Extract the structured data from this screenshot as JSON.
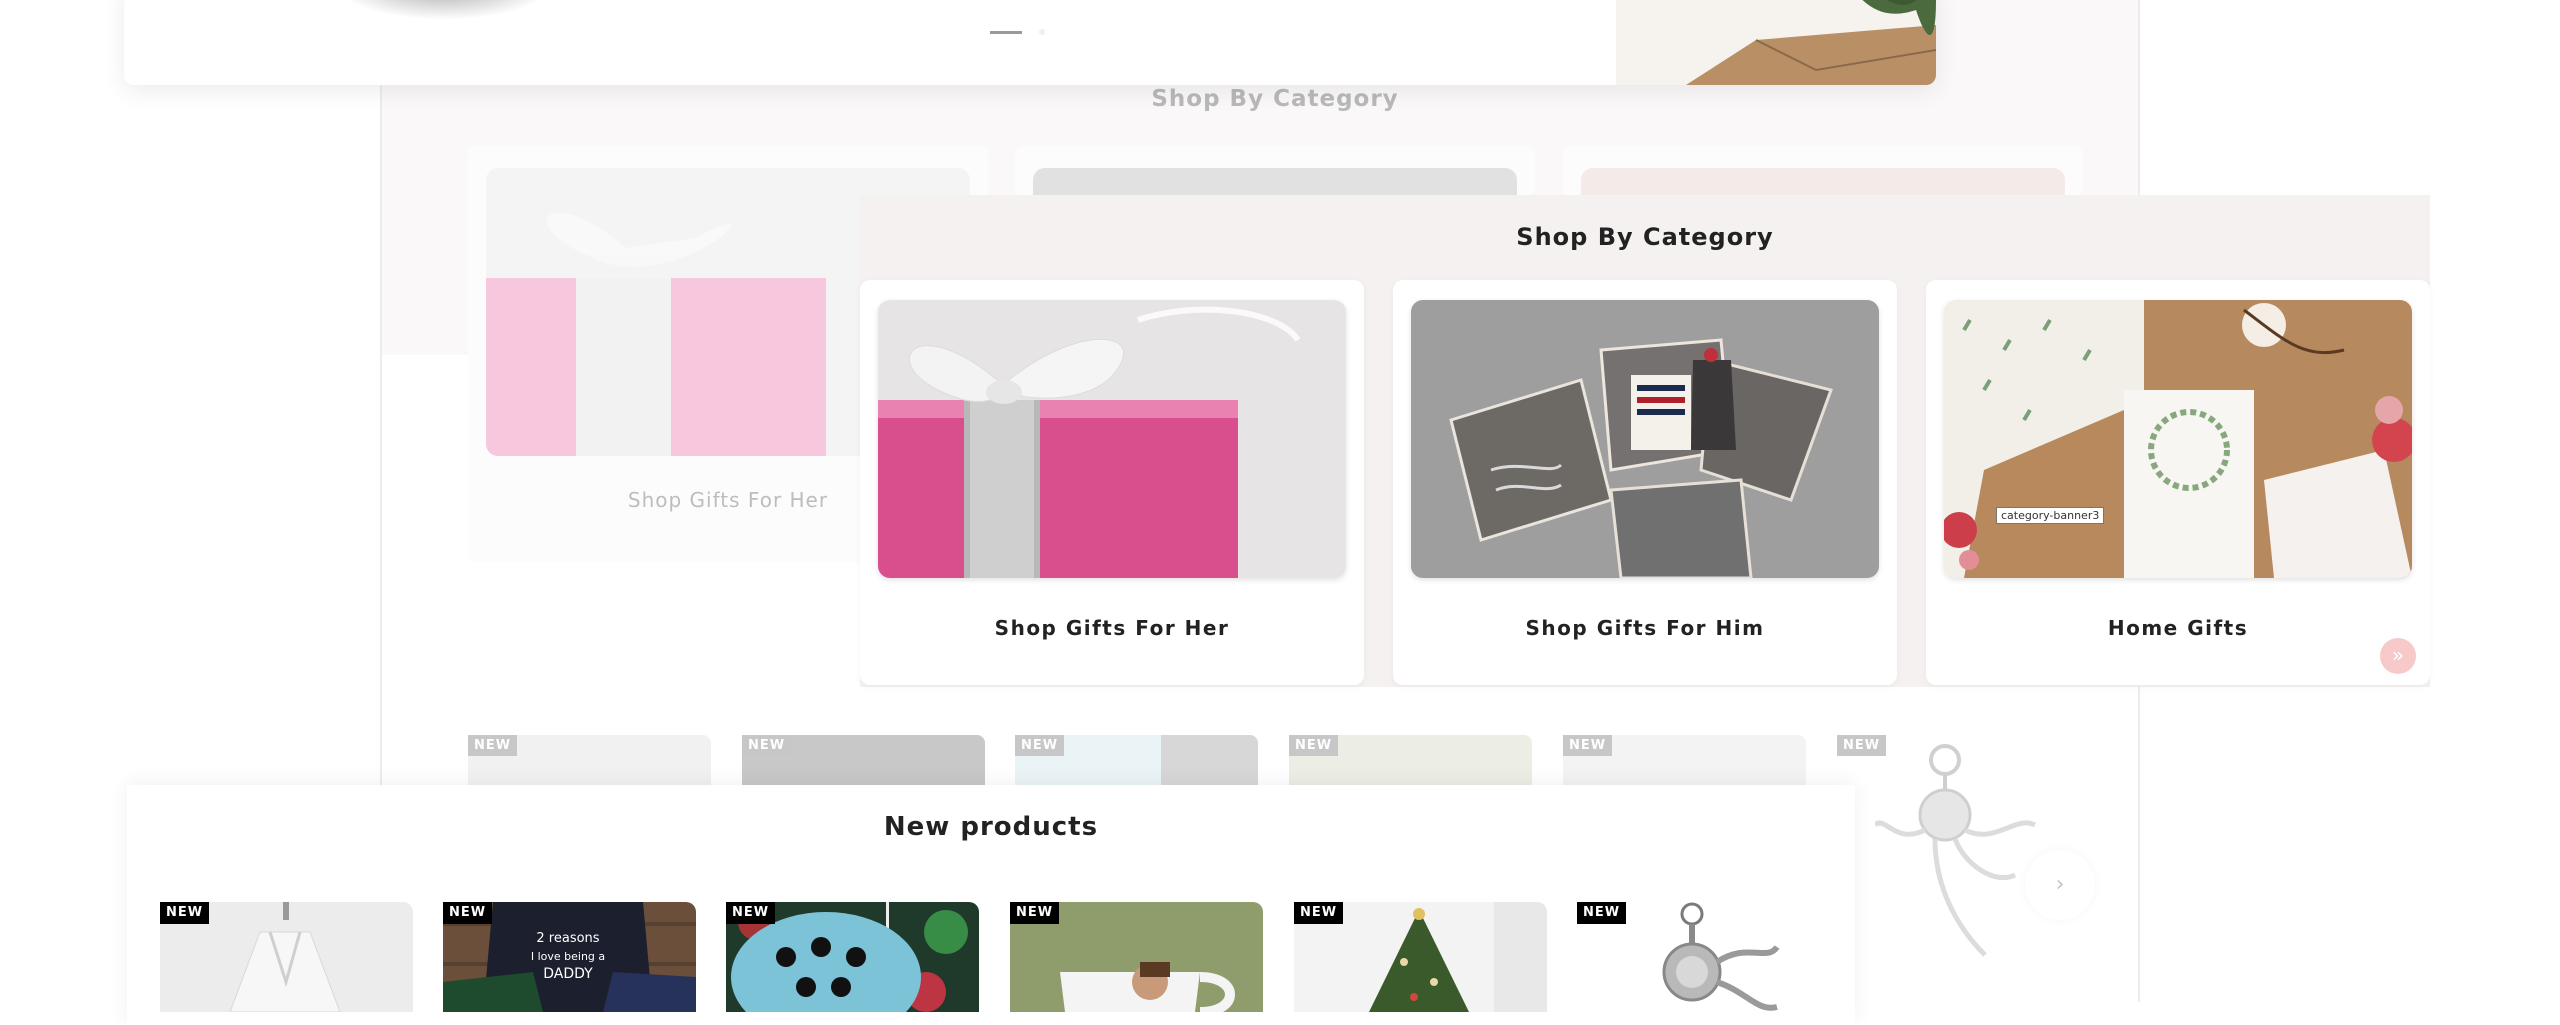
{
  "background": {
    "section_title": "Shop By Category",
    "first_card_label": "Shop Gifts For Her",
    "new_badges": [
      "NEW",
      "NEW",
      "NEW",
      "NEW",
      "NEW",
      "NEW"
    ],
    "carousel_next_icon": "chevron-right-icon"
  },
  "category_section": {
    "title": "Shop By Category",
    "cards": [
      {
        "label": "Shop Gifts For Her",
        "image": "pink-gift-box"
      },
      {
        "label": "Shop Gifts For Him",
        "image": "explosion-gift-box"
      },
      {
        "label": "Home Gifts",
        "image": "stationery-flowers",
        "tooltip": "category-banner3"
      }
    ],
    "next_button_icon": "double-chevron-right-icon"
  },
  "new_products": {
    "title": "New products",
    "items": [
      {
        "badge": "NEW",
        "image": "white-bathrobe"
      },
      {
        "badge": "NEW",
        "image": "daddy-tshirts"
      },
      {
        "badge": "NEW",
        "image": "penguin-ornament"
      },
      {
        "badge": "NEW",
        "image": "photo-mug"
      },
      {
        "badge": "NEW",
        "image": "christmas-tree"
      },
      {
        "badge": "NEW",
        "image": "octopus-keychain"
      }
    ]
  },
  "colors": {
    "section_bg": "#f4f1f0",
    "badge_bg": "#000000",
    "next_button": "#f7c9c9"
  }
}
